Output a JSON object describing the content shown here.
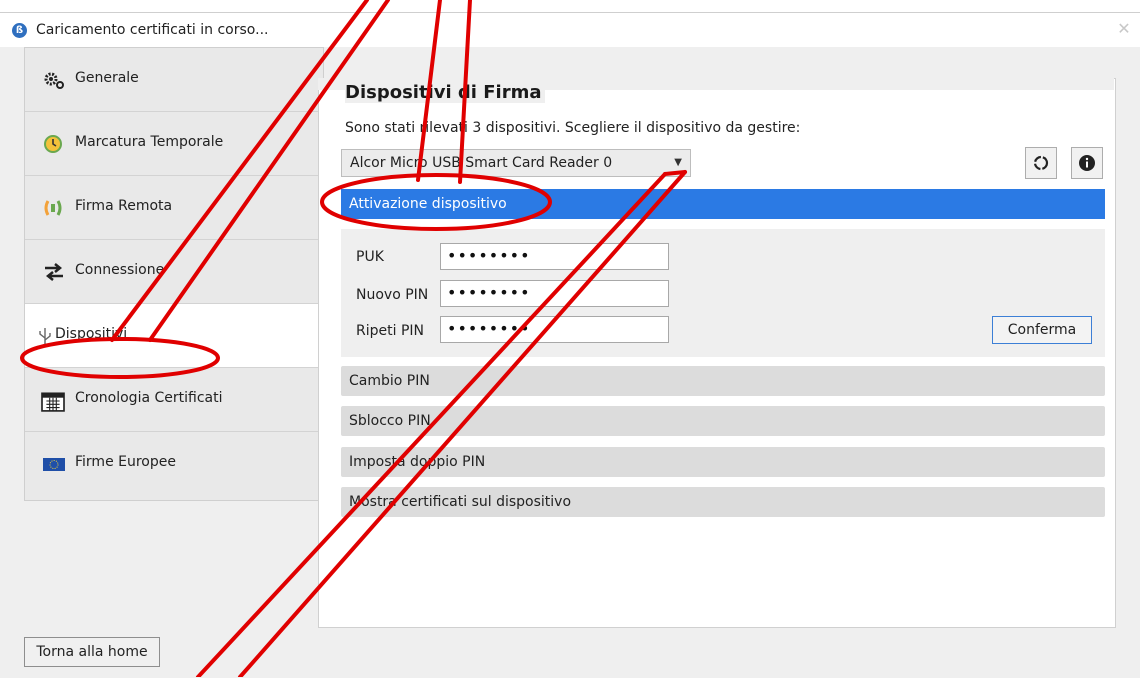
{
  "window": {
    "title": "Caricamento certificati in corso...",
    "app_icon": "app-logo-icon",
    "close_icon": "close-icon"
  },
  "sidebar": {
    "items": [
      {
        "label": "Generale",
        "icon": "gears-icon"
      },
      {
        "label": "Marcatura Temporale",
        "icon": "clock-icon"
      },
      {
        "label": "Firma Remota",
        "icon": "remote-signature-icon"
      },
      {
        "label": "Connessione",
        "icon": "arrows-exchange-icon"
      },
      {
        "label": "Dispositivi",
        "icon": "usb-icon",
        "active": true
      },
      {
        "label": "Cronologia Certificati",
        "icon": "calendar-icon"
      },
      {
        "label": "Firme Europee",
        "icon": "eu-flag-icon"
      }
    ]
  },
  "main": {
    "section_title": "Dispositivi di Firma",
    "instructions": "Sono stati rilevati 3 dispositivi. Scegliere il dispositivo da gestire:",
    "device_select": {
      "value": "Alcor Micro USB Smart Card Reader 0"
    },
    "refresh_icon": "refresh-icon",
    "info_icon": "info-icon",
    "accordion": [
      {
        "label": "Attivazione dispositivo",
        "expanded": true
      },
      {
        "label": "Cambio PIN"
      },
      {
        "label": "Sblocco PIN"
      },
      {
        "label": "Imposta doppio PIN"
      },
      {
        "label": "Mostra certificati sul dispositivo"
      }
    ],
    "activation_form": {
      "puk_label": "PUK",
      "puk_value": "••••••••",
      "new_pin_label": "Nuovo PIN",
      "new_pin_value": "••••••••",
      "repeat_pin_label": "Ripeti PIN",
      "repeat_pin_value": "••••••••",
      "confirm_label": "Conferma"
    }
  },
  "footer": {
    "home_label": "Torna alla home"
  },
  "colors": {
    "accent": "#2b7ae4",
    "annotation": "#e00000"
  }
}
